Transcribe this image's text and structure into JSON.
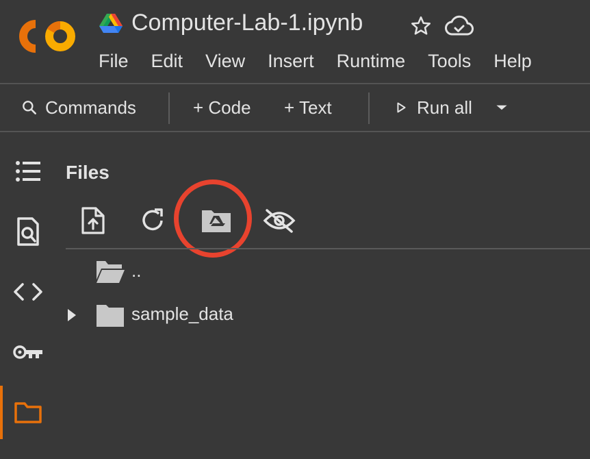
{
  "header": {
    "title": "Computer-Lab-1.ipynb",
    "menu": [
      "File",
      "Edit",
      "View",
      "Insert",
      "Runtime",
      "Tools",
      "Help"
    ]
  },
  "toolbar": {
    "commands": "Commands",
    "code": "+ Code",
    "text": "+ Text",
    "run_all": "Run all"
  },
  "sidebar": {
    "items": [
      {
        "icon": "table-of-contents-icon"
      },
      {
        "icon": "find-replace-icon"
      },
      {
        "icon": "code-snippets-icon"
      },
      {
        "icon": "secrets-key-icon"
      },
      {
        "icon": "folder-icon",
        "active": true
      }
    ]
  },
  "files": {
    "title": "Files",
    "tools": [
      "upload-icon",
      "refresh-icon",
      "mount-drive-icon",
      "hide-files-icon"
    ],
    "entries": [
      {
        "label": "..",
        "type": "parent-folder"
      },
      {
        "label": "sample_data",
        "type": "folder"
      }
    ]
  },
  "colors": {
    "background": "#383838",
    "text": "#e3e3e3",
    "accent": "#e8710a",
    "highlight": "#e8432e"
  }
}
